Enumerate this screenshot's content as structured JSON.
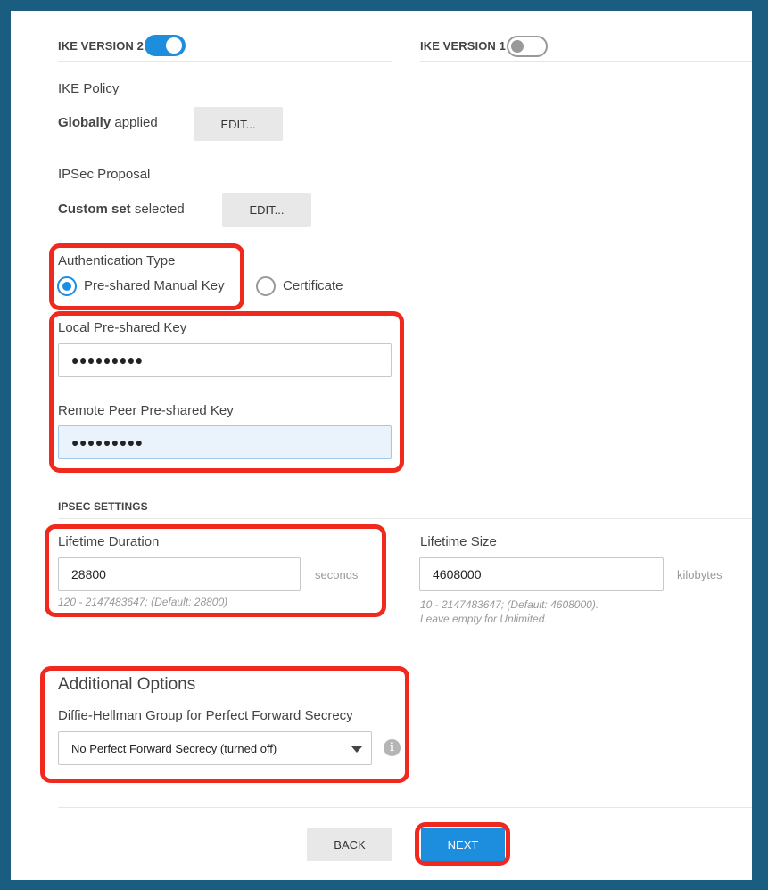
{
  "ike_v2": {
    "label": "IKE VERSION 2",
    "enabled": true
  },
  "ike_v1": {
    "label": "IKE VERSION 1",
    "enabled": false
  },
  "ike_policy": {
    "heading": "IKE Policy",
    "status_bold": "Globally",
    "status_rest": " applied",
    "edit_label": "EDIT..."
  },
  "ipsec_proposal": {
    "heading": "IPSec Proposal",
    "status_bold": "Custom set",
    "status_rest": " selected",
    "edit_label": "EDIT..."
  },
  "auth": {
    "heading": "Authentication Type",
    "options": [
      {
        "label": "Pre-shared Manual Key",
        "selected": true
      },
      {
        "label": "Certificate",
        "selected": false
      }
    ]
  },
  "keys": {
    "local_label": "Local Pre-shared Key",
    "local_value": "●●●●●●●●●",
    "remote_label": "Remote Peer Pre-shared Key",
    "remote_value": "●●●●●●●●●"
  },
  "ipsec_settings": {
    "heading": "IPSEC SETTINGS",
    "lifetime_duration": {
      "label": "Lifetime Duration",
      "value": "28800",
      "unit": "seconds",
      "hint": "120 - 2147483647; (Default: 28800)"
    },
    "lifetime_size": {
      "label": "Lifetime Size",
      "value": "4608000",
      "unit": "kilobytes",
      "hint1": "10 - 2147483647; (Default: 4608000).",
      "hint2": "Leave empty for Unlimited."
    }
  },
  "additional": {
    "heading": "Additional Options",
    "dh_label": "Diffie-Hellman Group for Perfect Forward Secrecy",
    "dh_selected": "No Perfect Forward Secrecy (turned off)"
  },
  "footer": {
    "back_label": "BACK",
    "next_label": "NEXT"
  },
  "colors": {
    "accent": "#1d8ede",
    "highlight": "#f0281e",
    "frame": "#1a5d80"
  }
}
